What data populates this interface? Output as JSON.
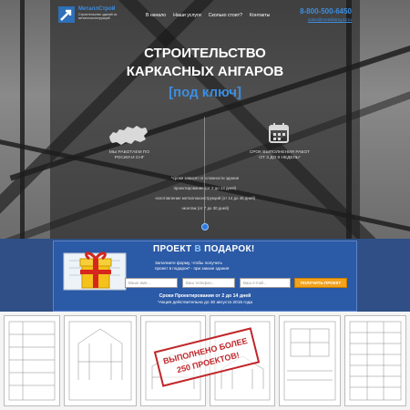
{
  "header": {
    "logo_name": "МеталлСтрой",
    "logo_tagline": "Строительство зданий из металлоконструкций",
    "nav": [
      "В начало",
      "Наши услуги",
      "Сколько стоит?",
      "Контакты"
    ],
    "phone": "8-800-500-6450",
    "email": "sales@metallstroy43.ru"
  },
  "hero": {
    "title_line1": "СТРОИТЕЛЬСТВО",
    "title_line2": "КАРКАСНЫХ АНГАРОВ",
    "title_line3": "[под ключ]",
    "feature_left": "МЫ РАБОТАЕМ ПО РОСИИ И СНГ",
    "feature_right": "СРОК ВЫПОЛНЕНИЯ РАБОТ ОТ 3 ДО 9 НЕДЕЛЬ*",
    "info_lines": [
      "*сроки зависят от сложности здания",
      "проектирование (от 2 до 14 дней)",
      "-изготовление металлоконструкций (от 14 до 45 дней)",
      "-монтаж (от 7 до 30 дней)"
    ]
  },
  "promo": {
    "title_a": "ПРОЕКТ",
    "title_b": "В",
    "title_c": "ПОДАРОК!",
    "text_line1": "Заполните форму, чтобы получить",
    "text_line2": "проект в подарок* - при заказе здания",
    "name_placeholder": "Ваше имя...",
    "phone_placeholder": "Ваш телефон...",
    "email_placeholder": "Ваш e-mail...",
    "button_label": "ПОЛУЧИТЬ ПРОЕКТ",
    "bottom_line1": "Сроки Проектирования от 2 до 14 дней",
    "bottom_line2": "*Акция действительна до 30 августа 2015 года"
  },
  "drawings": {
    "stamp_line1": "ВЫПОЛНЕНО БОЛЕЕ",
    "stamp_line2": "250 ПРОЕКТОВ!"
  },
  "colors": {
    "accent_blue": "#3d8ee0",
    "promo_blue": "#2b5aa6",
    "button_orange": "#f2a21d",
    "stamp_red": "#c0262a"
  }
}
